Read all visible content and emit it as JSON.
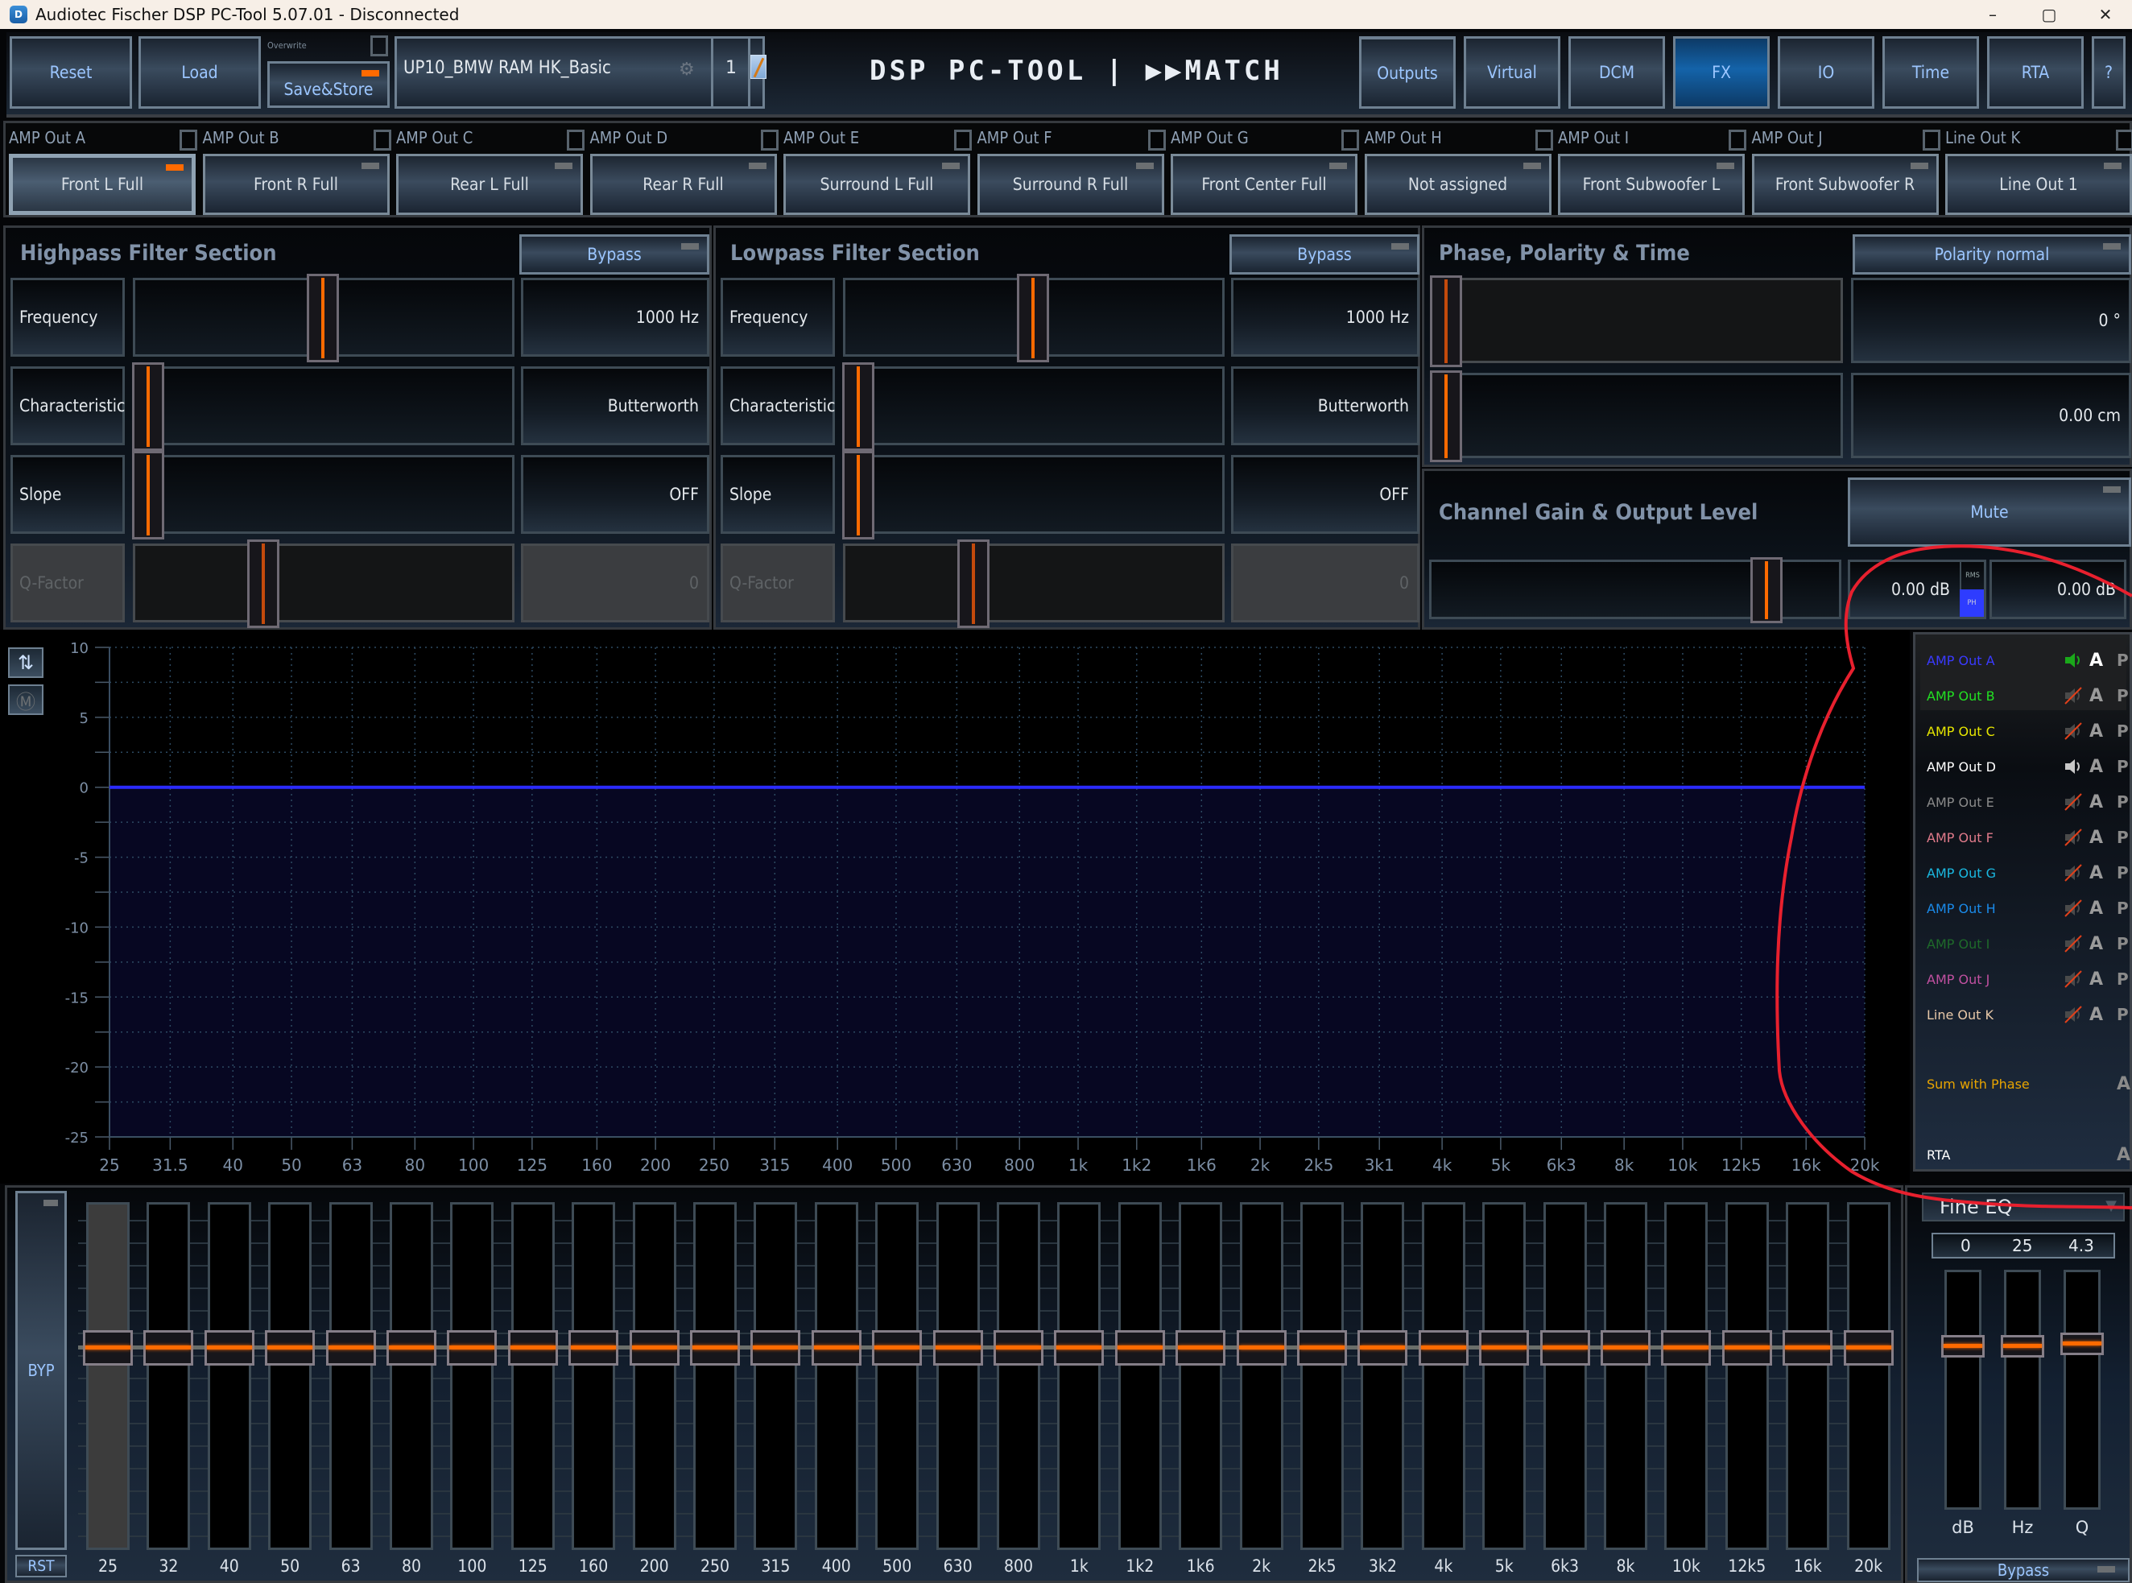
{
  "window": {
    "title": "Audiotec Fischer DSP PC-Tool 5.07.01 - Disconnected",
    "controls": {
      "minimize": "–",
      "maximize": "▢",
      "close": "✕"
    }
  },
  "toolbar": {
    "reset_label": "Reset",
    "load_label": "Load",
    "overwrite_label": "Overwrite",
    "save_store_label": "Save&Store",
    "setup_name": "UP10_BMW RAM HK_Basic",
    "preset_number": "1",
    "logo": "DSP PC-TOOL | ▶▶MATCH",
    "nav": [
      {
        "label": "Outputs",
        "active": false
      },
      {
        "label": "Virtual",
        "active": false
      },
      {
        "label": "DCM",
        "active": false
      },
      {
        "label": "FX",
        "active": true
      },
      {
        "label": "IO",
        "active": false
      },
      {
        "label": "Time",
        "active": false
      },
      {
        "label": "RTA",
        "active": false
      },
      {
        "label": "?",
        "active": false
      }
    ]
  },
  "channels": [
    {
      "output": "AMP Out A",
      "name": "Front L Full",
      "selected": true
    },
    {
      "output": "AMP Out B",
      "name": "Front R Full",
      "selected": false
    },
    {
      "output": "AMP Out C",
      "name": "Rear L Full",
      "selected": false
    },
    {
      "output": "AMP Out D",
      "name": "Rear R Full",
      "selected": false
    },
    {
      "output": "AMP Out E",
      "name": "Surround L Full",
      "selected": false
    },
    {
      "output": "AMP Out F",
      "name": "Surround R Full",
      "selected": false
    },
    {
      "output": "AMP Out G",
      "name": "Front Center Full",
      "selected": false
    },
    {
      "output": "AMP Out H",
      "name": "Not assigned",
      "selected": false
    },
    {
      "output": "AMP Out I",
      "name": "Front Subwoofer L",
      "selected": false
    },
    {
      "output": "AMP Out J",
      "name": "Front Subwoofer R",
      "selected": false
    },
    {
      "output": "Line Out K",
      "name": "Line Out 1",
      "selected": false
    }
  ],
  "highpass": {
    "title": "Highpass Filter Section",
    "bypass_label": "Bypass",
    "rows": [
      {
        "label": "Frequency",
        "value": "1000 Hz",
        "position": 0.5,
        "disabled": false
      },
      {
        "label": "Characteristic",
        "value": "Butterworth",
        "position": 0.0,
        "disabled": false
      },
      {
        "label": "Slope",
        "value": "OFF",
        "position": 0.0,
        "disabled": false
      },
      {
        "label": "Q-Factor",
        "value": "0",
        "position": 0.33,
        "disabled": true
      }
    ]
  },
  "lowpass": {
    "title": "Lowpass Filter Section",
    "bypass_label": "Bypass",
    "rows": [
      {
        "label": "Frequency",
        "value": "1000 Hz",
        "position": 0.5,
        "disabled": false
      },
      {
        "label": "Characteristic",
        "value": "Butterworth",
        "position": 0.0,
        "disabled": false
      },
      {
        "label": "Slope",
        "value": "OFF",
        "position": 0.0,
        "disabled": false
      },
      {
        "label": "Q-Factor",
        "value": "0",
        "position": 0.33,
        "disabled": true
      }
    ]
  },
  "phase": {
    "title": "Phase, Polarity & Time",
    "polarity_label": "Polarity normal",
    "phase_value": "0 °",
    "phase_position": 0.0,
    "delay_value": "0.00 cm",
    "delay_position": 0.0
  },
  "gain": {
    "title": "Channel Gain & Output Level",
    "mute_label": "Mute",
    "gain_position": 0.86,
    "gain_value": "0.00 dB",
    "rms_label": "RMS",
    "ph_label": "PH",
    "output_value": "0.00 dB"
  },
  "graph_tools": {
    "swap_icon": "swap-arrows-icon",
    "measure_icon": "m-target-icon"
  },
  "chart_data": {
    "type": "line",
    "title": "",
    "xlabel": "",
    "ylabel": "",
    "x_scale": "log",
    "x_ticks": [
      "25",
      "31.5",
      "40",
      "50",
      "63",
      "80",
      "100",
      "125",
      "160",
      "200",
      "250",
      "315",
      "400",
      "500",
      "630",
      "800",
      "1k",
      "1k2",
      "1k6",
      "2k",
      "2k5",
      "3k1",
      "4k",
      "5k",
      "6k3",
      "8k",
      "10k",
      "12k5",
      "16k",
      "20k"
    ],
    "x_tick_values": [
      25,
      31.5,
      40,
      50,
      63,
      80,
      100,
      125,
      160,
      200,
      250,
      315,
      400,
      500,
      630,
      800,
      1000,
      1250,
      1600,
      2000,
      2500,
      3150,
      4000,
      5000,
      6300,
      8000,
      10000,
      12500,
      16000,
      20000
    ],
    "y_ticks": [
      10,
      5,
      0,
      -5,
      -10,
      -15,
      -20,
      -25
    ],
    "ylim": [
      -25,
      10
    ],
    "xlim": [
      25,
      20000
    ],
    "grid": true,
    "series": [
      {
        "name": "AMP Out A",
        "color": "#2b2bff",
        "fill_below": true,
        "x": [
          25,
          20000
        ],
        "y": [
          0,
          0
        ]
      }
    ]
  },
  "channel_list": {
    "items": [
      {
        "label": "AMP Out A",
        "color": "#3a3aff",
        "speaker": "on",
        "a_active": true
      },
      {
        "label": "AMP Out B",
        "color": "#22e022",
        "speaker": "muted",
        "a_active": false
      },
      {
        "label": "AMP Out C",
        "color": "#e6e600",
        "speaker": "muted",
        "a_active": false
      },
      {
        "label": "AMP Out D",
        "color": "#ffffff",
        "speaker": "on-grey",
        "a_active": false
      },
      {
        "label": "AMP Out E",
        "color": "#8a8a8a",
        "speaker": "muted",
        "a_active": false
      },
      {
        "label": "AMP Out F",
        "color": "#e07a8a",
        "speaker": "muted",
        "a_active": false
      },
      {
        "label": "AMP Out G",
        "color": "#1ab8e0",
        "speaker": "muted",
        "a_active": false
      },
      {
        "label": "AMP Out H",
        "color": "#1a8ae8",
        "speaker": "muted",
        "a_active": false
      },
      {
        "label": "AMP Out I",
        "color": "#1e6a2a",
        "speaker": "muted",
        "a_active": false
      },
      {
        "label": "AMP Out J",
        "color": "#c050a0",
        "speaker": "muted",
        "a_active": false
      },
      {
        "label": "Line Out K",
        "color": "#e8c8a8",
        "speaker": "muted",
        "a_active": false
      }
    ],
    "a_label": "A",
    "p_label": "P",
    "sum_label": "Sum with Phase",
    "sum_color": "#e8a400",
    "rta_label": "RTA"
  },
  "eq": {
    "bypass_label": "BYP",
    "reset_label": "RST",
    "bands": [
      {
        "label": "25",
        "gain_db": 0,
        "selected": true
      },
      {
        "label": "32",
        "gain_db": 0
      },
      {
        "label": "40",
        "gain_db": 0
      },
      {
        "label": "50",
        "gain_db": 0
      },
      {
        "label": "63",
        "gain_db": 0
      },
      {
        "label": "80",
        "gain_db": 0
      },
      {
        "label": "100",
        "gain_db": 0
      },
      {
        "label": "125",
        "gain_db": 0
      },
      {
        "label": "160",
        "gain_db": 0
      },
      {
        "label": "200",
        "gain_db": 0
      },
      {
        "label": "250",
        "gain_db": 0
      },
      {
        "label": "315",
        "gain_db": 0
      },
      {
        "label": "400",
        "gain_db": 0
      },
      {
        "label": "500",
        "gain_db": 0
      },
      {
        "label": "630",
        "gain_db": 0
      },
      {
        "label": "800",
        "gain_db": 0
      },
      {
        "label": "1k",
        "gain_db": 0
      },
      {
        "label": "1k2",
        "gain_db": 0
      },
      {
        "label": "1k6",
        "gain_db": 0
      },
      {
        "label": "2k",
        "gain_db": 0
      },
      {
        "label": "2k5",
        "gain_db": 0
      },
      {
        "label": "3k2",
        "gain_db": 0
      },
      {
        "label": "4k",
        "gain_db": 0
      },
      {
        "label": "5k",
        "gain_db": 0
      },
      {
        "label": "6k3",
        "gain_db": 0
      },
      {
        "label": "8k",
        "gain_db": 0
      },
      {
        "label": "10k",
        "gain_db": 0
      },
      {
        "label": "12k5",
        "gain_db": 0
      },
      {
        "label": "16k",
        "gain_db": 0
      },
      {
        "label": "20k",
        "gain_db": 0
      }
    ],
    "gain_position": 0.6
  },
  "fine_eq": {
    "mode": "Fine EQ",
    "values": {
      "db": "0",
      "hz": "25",
      "q": "4.3"
    },
    "labels": {
      "db": "dB",
      "hz": "Hz",
      "q": "Q"
    },
    "positions": {
      "db": 0.3,
      "hz": 0.3,
      "q": 0.29
    },
    "bypass_label": "Bypass"
  },
  "annotation": {
    "color": "#e8202e"
  }
}
